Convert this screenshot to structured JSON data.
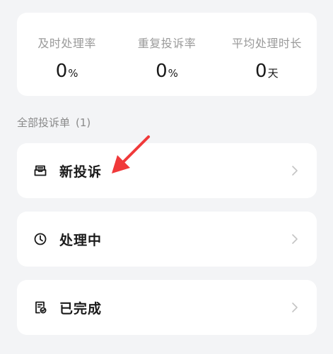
{
  "stats": [
    {
      "label": "及时处理率",
      "value": "0",
      "unit": "%"
    },
    {
      "label": "重复投诉率",
      "value": "0",
      "unit": "%"
    },
    {
      "label": "平均处理时长",
      "value": "0",
      "unit": "天"
    }
  ],
  "section": {
    "title": "全部投诉单",
    "count": "(1)"
  },
  "rows": [
    {
      "label": "新投诉",
      "icon": "inbox-icon"
    },
    {
      "label": "处理中",
      "icon": "clock-icon"
    },
    {
      "label": "已完成",
      "icon": "document-check-icon"
    }
  ],
  "colors": {
    "background": "#f3f4f6",
    "card": "#ffffff",
    "annotation_arrow": "#f0393a"
  }
}
